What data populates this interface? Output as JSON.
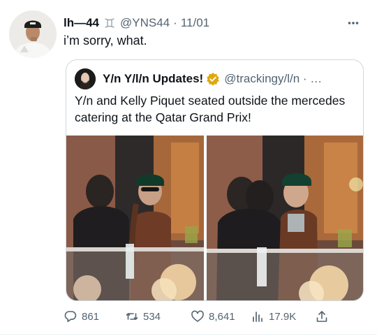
{
  "tweet": {
    "display_name": "lh—44",
    "badge_icon": "gemini-zodiac-icon",
    "handle": "@YNS44",
    "separator": "·",
    "timestamp": "11/01",
    "text": "i’m sorry, what.",
    "more_icon": "more-horizontal-icon"
  },
  "quote": {
    "display_name": "Y/n Y/l/n Updates!",
    "verified_icon": "verified-badge-icon",
    "verified_color": "#e0a80f",
    "handle": "@trackingy/l/n · …",
    "text": "Y/n and Kelly Piquet seated outside the mercedes catering at the Qatar Grand Prix!"
  },
  "actions": {
    "reply": {
      "icon": "reply-icon",
      "count": "861"
    },
    "retweet": {
      "icon": "retweet-icon",
      "count": "534"
    },
    "like": {
      "icon": "heart-icon",
      "count": "8,641"
    },
    "views": {
      "icon": "views-chart-icon",
      "count": "17.9K"
    },
    "share": {
      "icon": "share-icon"
    }
  },
  "colors": {
    "text_primary": "#0f1419",
    "text_secondary": "#536471",
    "border": "#cfd9de"
  }
}
